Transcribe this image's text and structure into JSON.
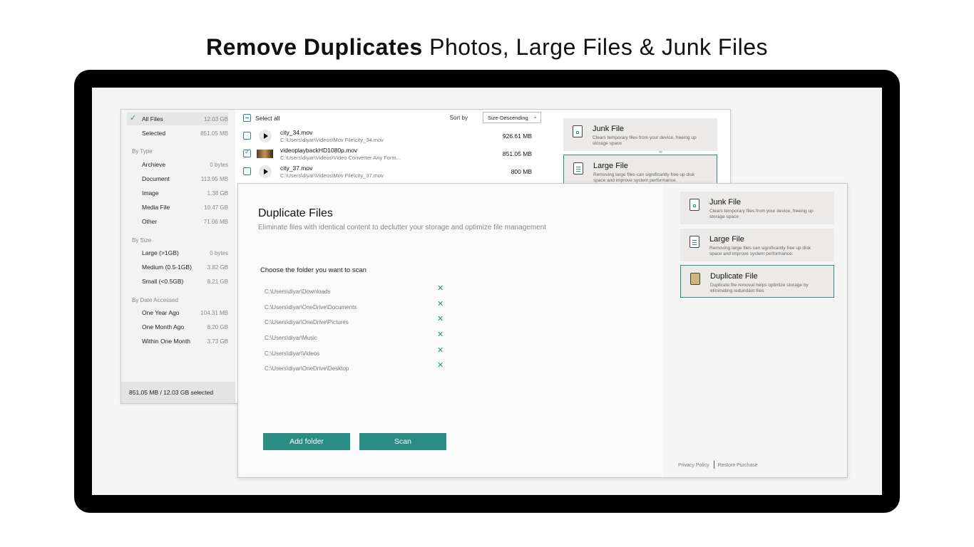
{
  "headline": {
    "bold": "Remove Duplicates",
    "rest": "Photos, Large Files & Junk Files"
  },
  "back_window": {
    "sidebar": {
      "top_items": [
        {
          "label": "All Files",
          "value": "12.03 GB",
          "active": true
        },
        {
          "label": "Selected",
          "value": "851.05 MB"
        }
      ],
      "groups": [
        {
          "heading": "By Type",
          "items": [
            {
              "label": "Archieve",
              "value": "0 bytes"
            },
            {
              "label": "Document",
              "value": "113.95 MB"
            },
            {
              "label": "Image",
              "value": "1.38 GB"
            },
            {
              "label": "Media File",
              "value": "10.47 GB"
            },
            {
              "label": "Other",
              "value": "71.06 MB"
            }
          ]
        },
        {
          "heading": "By Size",
          "items": [
            {
              "label": "Large (>1GB)",
              "value": "0 bytes"
            },
            {
              "label": "Medium (0.5-1GB)",
              "value": "3.82 GB"
            },
            {
              "label": "Small (<0.5GB)",
              "value": "8.21 GB"
            }
          ]
        },
        {
          "heading": "By Date Accessed",
          "items": [
            {
              "label": "One Year Ago",
              "value": "104.31 MB"
            },
            {
              "label": "One Month Ago",
              "value": "8.20 GB"
            },
            {
              "label": "Within One Month",
              "value": "3.73 GB"
            }
          ]
        }
      ],
      "status": "851.05 MB / 12.03 GB selected"
    },
    "list": {
      "select_all": "Select all",
      "sort_label": "Sort by",
      "sort_value": "Size-Descending",
      "files": [
        {
          "name": "city_34.mov",
          "path": "C:\\Users\\diyar\\Videos\\Mov File\\city_34.mov",
          "size": "926.61 MB",
          "checked": false,
          "thumb": "play-icon"
        },
        {
          "name": "videoplaybackHD1080p.mov",
          "path": "C:\\Users\\diyar\\Videos\\Video Converter Any Form...",
          "size": "851.05 MB",
          "checked": true,
          "thumb": "video-thumbnail"
        },
        {
          "name": "city_37.mov",
          "path": "C:\\Users\\diyar\\Videos\\Mov File\\city_37.mov",
          "size": "800 MB",
          "checked": false,
          "thumb": "play-icon"
        }
      ]
    },
    "cards": [
      {
        "title": "Junk File",
        "desc": "Clears temporary files from your device, freeing up storage space",
        "icon": "junk-file-icon"
      },
      {
        "title": "Large File",
        "desc": "Removing large files can significantly free up disk space and improve system performance.",
        "icon": "large-file-icon",
        "selected": true
      }
    ]
  },
  "front_window": {
    "title": "Duplicate Files",
    "subtitle": "Eliminate files with identical content to declutter your storage and optimize file management",
    "choose_label": "Choose the folder you want to scan",
    "folders": [
      "C:\\Users\\diyar\\Downloads",
      "C:\\Users\\diyar\\OneDrive\\Documents",
      "C:\\Users\\diyar\\OneDrive\\Pictures",
      "C:\\Users\\diyar\\Music",
      "C:\\Users\\diyar\\Videos",
      "C:\\Users\\diyar\\OneDrive\\Desktop"
    ],
    "add_folder_label": "Add folder",
    "scan_label": "Scan",
    "cards": [
      {
        "title": "Junk File",
        "desc": "Clears temporary files from your device, freeing up storage space",
        "icon": "junk-file-icon"
      },
      {
        "title": "Large File",
        "desc": "Removing large files can significantly free up disk space and improve system performance.",
        "icon": "large-file-icon"
      },
      {
        "title": "Duplicate File",
        "desc": "Duplicate file removal helps optimize storage by eliminating redundant files",
        "icon": "duplicate-file-icon",
        "selected": true
      }
    ],
    "privacy_label": "Privacy Policy",
    "restore_label": "Restore Purchase"
  },
  "colors": {
    "accent": "#2a8c85",
    "card_bg": "#eceae8",
    "frame": "#000000"
  }
}
